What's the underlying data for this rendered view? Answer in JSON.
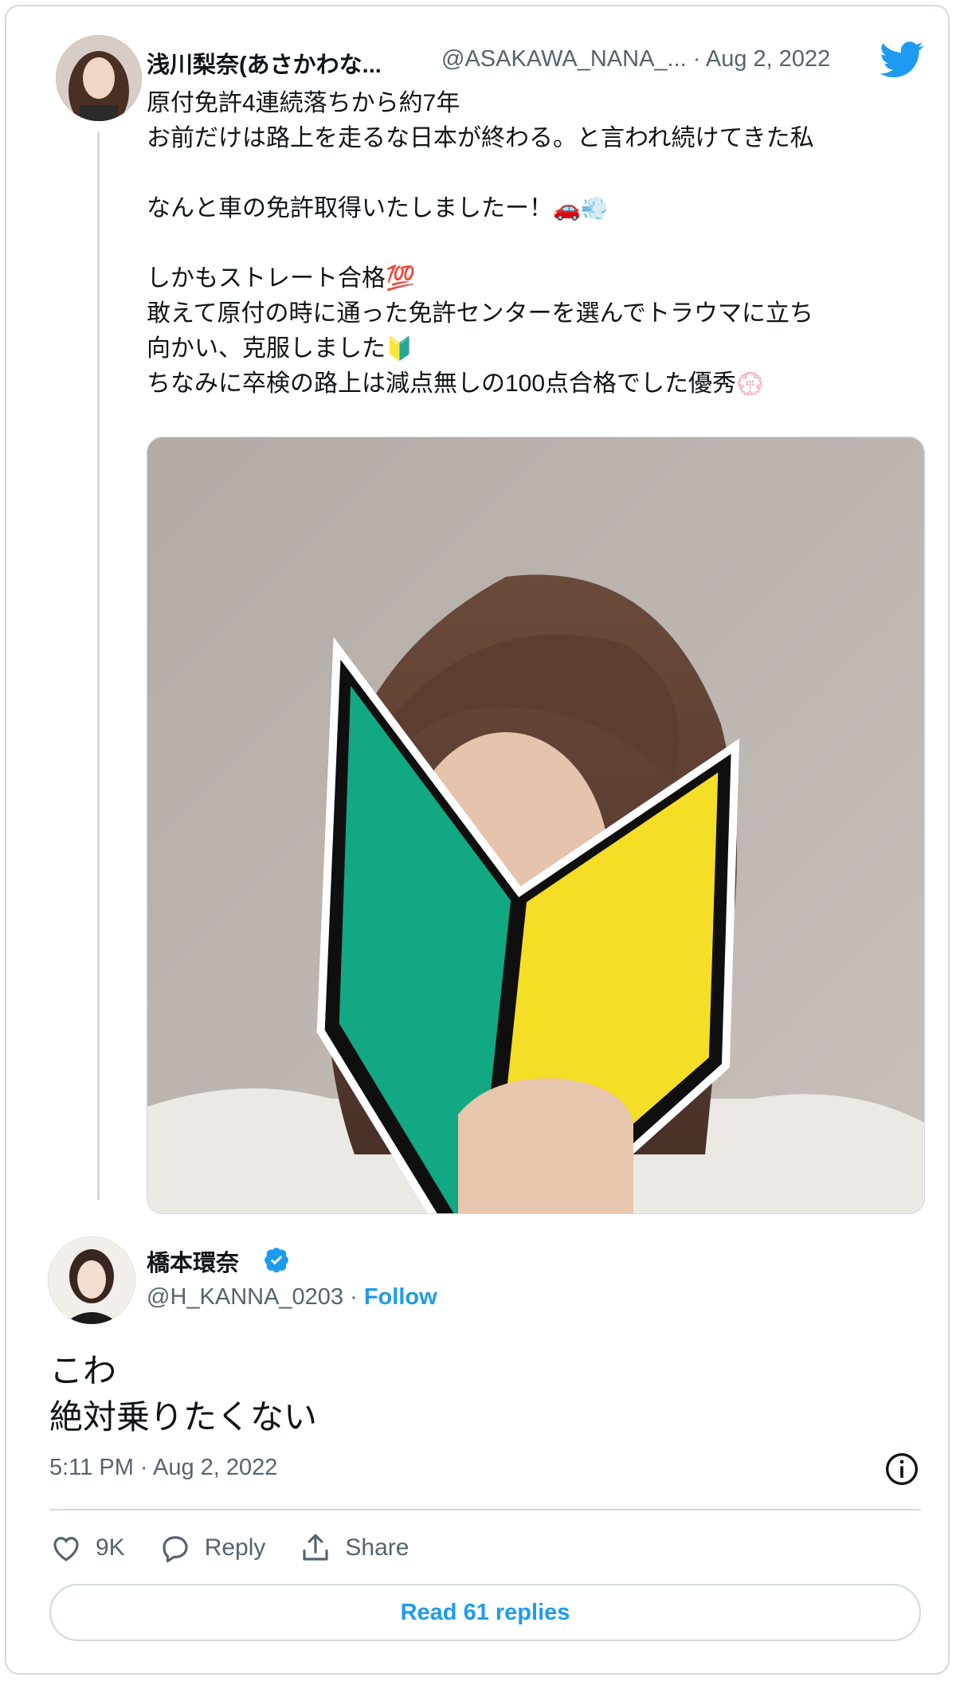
{
  "original_tweet": {
    "author_name": "浅川梨奈(あさかわな...",
    "handle_and_date": "@ASAKAWA_NANA_... · Aug 2, 2022",
    "lines": {
      "l1": "原付免許4連続落ちから約7年",
      "l2": "お前だけは路上を走るな日本が終わる。と言われ続けてきた私",
      "l3": "なんと車の免許取得いたしましたー！",
      "l4": "しかもストレート合格",
      "l4_emoji": "💯",
      "l5": "敢えて原付の時に通った免許センターを選んでトラウマに立ち",
      "l6": "向かい、克服しました",
      "l7": "ちなみに卒検の路上は減点無しの100点合格でした優秀"
    },
    "emoji_car": "🚗",
    "emoji_dash": "💨",
    "emoji_beginner": "🔰",
    "emoji_flower": "💮"
  },
  "reply_tweet": {
    "author_name": "橋本環奈",
    "handle": "@H_KANNA_0203 · ",
    "follow_label": "Follow",
    "text_line1": "こわ",
    "text_line2": "絶対乗りたくない",
    "timestamp": "5:11 PM · Aug 2, 2022"
  },
  "actions": {
    "like_count": "9K",
    "reply_label": "Reply",
    "share_label": "Share"
  },
  "read_replies_label": "Read 61 replies",
  "colors": {
    "accent": "#1d9bf0",
    "text": "#0f1419",
    "muted": "#536471",
    "border": "#cfd9de",
    "shoshinsha_green": "#12a884",
    "shoshinsha_yellow": "#f5de26"
  },
  "icons": {
    "brand": "twitter-bird-icon",
    "verified": "verified-badge-icon",
    "info": "info-icon",
    "like": "heart-icon",
    "reply": "speech-bubble-icon",
    "share": "share-upload-icon"
  }
}
